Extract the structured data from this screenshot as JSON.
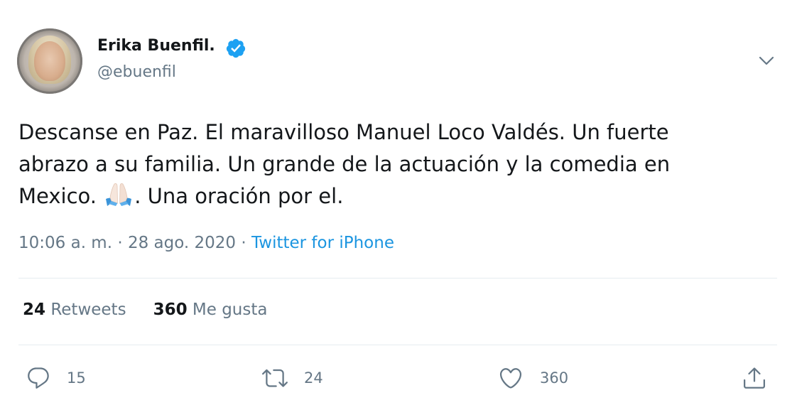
{
  "user": {
    "display_name": "Erika Buenfil.",
    "handle": "@ebuenfil",
    "verified": true
  },
  "tweet": {
    "text_lines": [
      "Descanse en Paz. El maravilloso Manuel Loco Valdés. Un fuerte",
      "abrazo a su familia. Un grande de la actuación y la comedia en",
      "Mexico. "
    ],
    "text_after_emoji": ". Una oración por el.",
    "emoji": "folded-hands",
    "time": "10:06 a. m.",
    "date": "28 ago. 2020",
    "separator": "·",
    "source": "Twitter for iPhone"
  },
  "stats": {
    "retweets_count": "24",
    "retweets_label": "Retweets",
    "likes_count": "360",
    "likes_label": "Me gusta"
  },
  "actions": {
    "reply_count": "15",
    "retweet_count": "24",
    "like_count": "360"
  },
  "colors": {
    "text": "#14171a",
    "secondary": "#657786",
    "link": "#1b95e0",
    "verified": "#1da1f2",
    "divider": "#e6ecf0"
  }
}
